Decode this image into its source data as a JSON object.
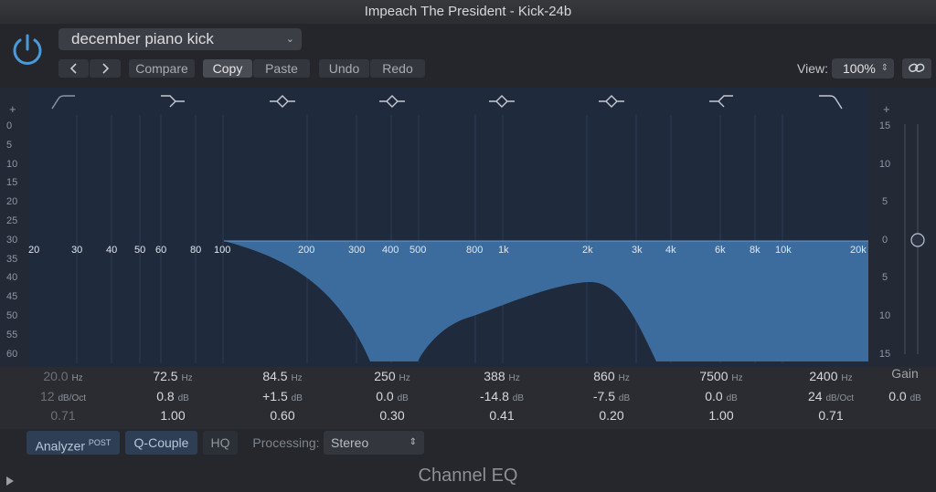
{
  "window": {
    "title": "Impeach The President - Kick-24b"
  },
  "header": {
    "preset_name": "december piano kick",
    "buttons": {
      "compare": "Compare",
      "copy": "Copy",
      "paste": "Paste",
      "undo": "Undo",
      "redo": "Redo"
    },
    "view_label": "View:",
    "view_value": "100%",
    "icons": {
      "power": "power-icon",
      "link": "link-icon",
      "prev": "chevron-left-icon",
      "next": "chevron-right-icon"
    }
  },
  "graph": {
    "plus_left": "+",
    "plus_right": "+",
    "left_ticks": [
      "0",
      "5",
      "10",
      "15",
      "20",
      "25",
      "30",
      "35",
      "40",
      "45",
      "50",
      "55",
      "60"
    ],
    "right_ticks": [
      "15",
      "10",
      "5",
      "0",
      "5",
      "10",
      "15"
    ],
    "freq_labels": [
      "20",
      "30",
      "40",
      "50",
      "60",
      "80",
      "100",
      "200",
      "300",
      "400",
      "500",
      "800",
      "1k",
      "2k",
      "3k",
      "4k",
      "6k",
      "8k",
      "10k",
      "20k"
    ],
    "fill_color": "#3f72a6",
    "line_color": "#5b8ec4"
  },
  "bands": [
    {
      "freq": "20.0",
      "freq_unit": "Hz",
      "gain": "12",
      "gain_unit": "dB/Oct",
      "q": "0.71",
      "enabled": false,
      "shape": "low-cut"
    },
    {
      "freq": "72.5",
      "freq_unit": "Hz",
      "gain": "0.8",
      "gain_unit": "dB",
      "q": "1.00",
      "enabled": true,
      "shape": "low-shelf"
    },
    {
      "freq": "84.5",
      "freq_unit": "Hz",
      "gain": "+1.5",
      "gain_unit": "dB",
      "q": "0.60",
      "enabled": true,
      "shape": "bell"
    },
    {
      "freq": "250",
      "freq_unit": "Hz",
      "gain": "0.0",
      "gain_unit": "dB",
      "q": "0.30",
      "enabled": true,
      "shape": "bell"
    },
    {
      "freq": "388",
      "freq_unit": "Hz",
      "gain": "-14.8",
      "gain_unit": "dB",
      "q": "0.41",
      "enabled": true,
      "shape": "bell"
    },
    {
      "freq": "860",
      "freq_unit": "Hz",
      "gain": "-7.5",
      "gain_unit": "dB",
      "q": "0.20",
      "enabled": true,
      "shape": "bell"
    },
    {
      "freq": "7500",
      "freq_unit": "Hz",
      "gain": "0.0",
      "gain_unit": "dB",
      "q": "1.00",
      "enabled": true,
      "shape": "high-shelf"
    },
    {
      "freq": "2400",
      "freq_unit": "Hz",
      "gain": "24",
      "gain_unit": "dB/Oct",
      "q": "0.71",
      "enabled": true,
      "shape": "high-cut"
    }
  ],
  "gain": {
    "label": "Gain",
    "value": "0.0",
    "unit": "dB"
  },
  "options": {
    "analyzer": "Analyzer",
    "analyzer_mode": "POST",
    "q_couple": "Q-Couple",
    "hq": "HQ",
    "processing_label": "Processing:",
    "processing_value": "Stereo"
  },
  "footer": {
    "title": "Channel EQ"
  }
}
